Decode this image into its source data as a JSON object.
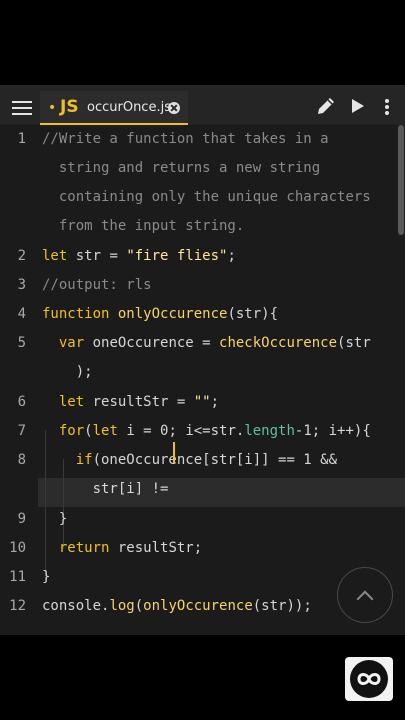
{
  "toolbar": {
    "tab": {
      "modified_marker": "•",
      "language_badge": "JS",
      "filename": "occurOnce.js"
    },
    "icons": [
      "menu-icon",
      "pencil-icon",
      "play-icon",
      "more-icon",
      "close-icon"
    ]
  },
  "editor": {
    "line_numbers": [
      "1",
      "2",
      "3",
      "4",
      "5",
      "6",
      "7",
      "8",
      "9",
      "10",
      "11",
      "12"
    ],
    "lines": [
      [
        "//Write a function that takes in a"
      ],
      [
        "  string and returns a new string"
      ],
      [
        "  containing only the unique characters"
      ],
      [
        "  from the input string."
      ],
      [
        "let",
        " str = ",
        "\"fire flies\"",
        ";"
      ],
      [
        "//output: rls"
      ],
      [
        "function",
        " ",
        "onlyOccurence",
        "(str){"
      ],
      [
        "  ",
        "var",
        " oneOccurence = ",
        "checkOccurence",
        "(str"
      ],
      [
        "    );"
      ],
      [
        "  ",
        "let",
        " resultStr = ",
        "\"\"",
        ";"
      ],
      [
        "  ",
        "for",
        "(",
        "let",
        " i = 0; i<=str.",
        "length",
        "-1; i++){"
      ],
      [
        "    ",
        "if",
        "(oneOccurence[str[i]] == 1 &&"
      ],
      [
        "      str[i] !="
      ],
      [
        "  }"
      ],
      [
        "  ",
        "return",
        " resultStr;"
      ],
      [
        "}"
      ],
      [
        "console.",
        "log",
        "(",
        "onlyOccurence",
        "(str));"
      ]
    ]
  },
  "accent_color": "#f0c020"
}
